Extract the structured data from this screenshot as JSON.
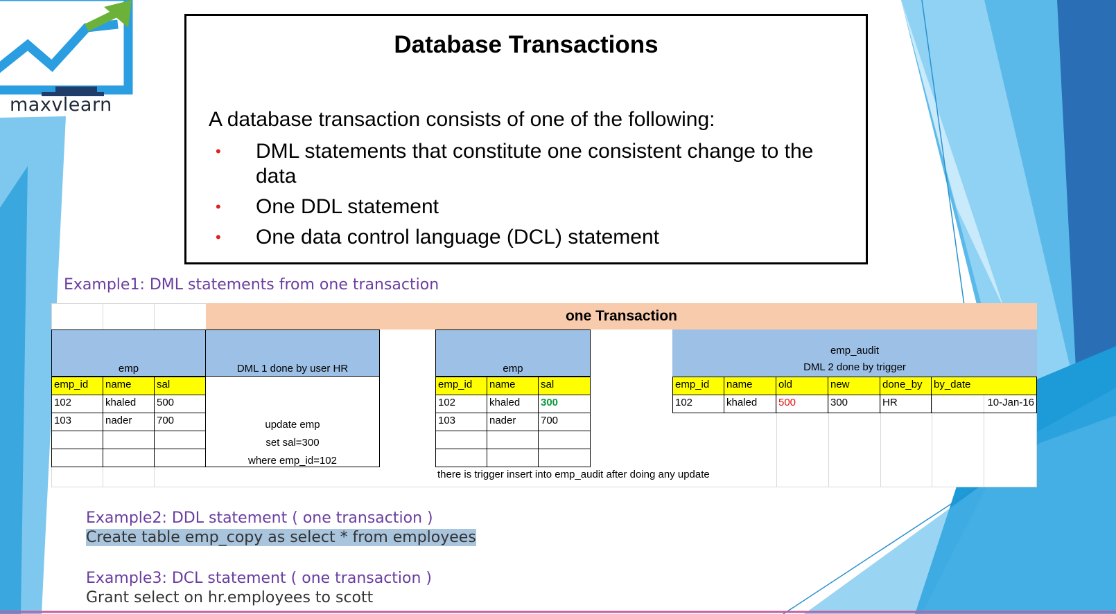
{
  "logo": {
    "text": "maxvlearn",
    "icon": "chart-monitor-logo-icon"
  },
  "definition": {
    "title": "Database Transactions",
    "intro": "A database transaction consists of one of the following:",
    "items": [
      "DML statements that constitute one consistent change to the data",
      "One DDL statement",
      "One data control language (DCL) statement"
    ]
  },
  "example1": {
    "heading": "Example1: DML statements from one transaction",
    "transaction_label": "one Transaction",
    "emp_before": {
      "title": "emp",
      "columns": [
        "emp_id",
        "name",
        "sal"
      ],
      "rows": [
        [
          "102",
          "khaled",
          "500"
        ],
        [
          "103",
          "nader",
          "700"
        ],
        [
          "",
          "",
          ""
        ],
        [
          "",
          "",
          ""
        ]
      ]
    },
    "dml1": {
      "title": "DML 1  done by user HR",
      "lines": [
        "update emp",
        "set sal=300",
        "where emp_id=102"
      ]
    },
    "emp_after": {
      "title": "emp",
      "columns": [
        "emp_id",
        "name",
        "sal"
      ],
      "rows": [
        [
          "102",
          "khaled",
          "300"
        ],
        [
          "103",
          "nader",
          "700"
        ],
        [
          "",
          "",
          ""
        ],
        [
          "",
          "",
          ""
        ]
      ]
    },
    "emp_audit": {
      "title": "emp_audit",
      "subtitle": "DML 2 done by trigger",
      "columns": [
        "emp_id",
        "name",
        "old",
        "new",
        "done_by",
        "by_date"
      ],
      "rows": [
        [
          "102",
          "khaled",
          "500",
          "300",
          "HR",
          "10-Jan-16"
        ]
      ]
    },
    "note": "there is trigger insert into emp_audit after doing any update"
  },
  "example2": {
    "heading": "Example2: DDL statement ( one transaction  )",
    "code": "Create table emp_copy as select * from employees"
  },
  "example3": {
    "heading": "Example3: DCL statement ( one transaction  )",
    "code": "Grant select on hr.employees to scott"
  },
  "colors": {
    "bullet": "#e02020",
    "heading": "#6a3da0",
    "header_blue": "#9cc0e6",
    "header_yellow": "#ffff00",
    "header_peach": "#f8cbad",
    "changed_value": "#0a9a3a",
    "old_value": "#e01010",
    "theme_blue": "#29a8e0"
  }
}
